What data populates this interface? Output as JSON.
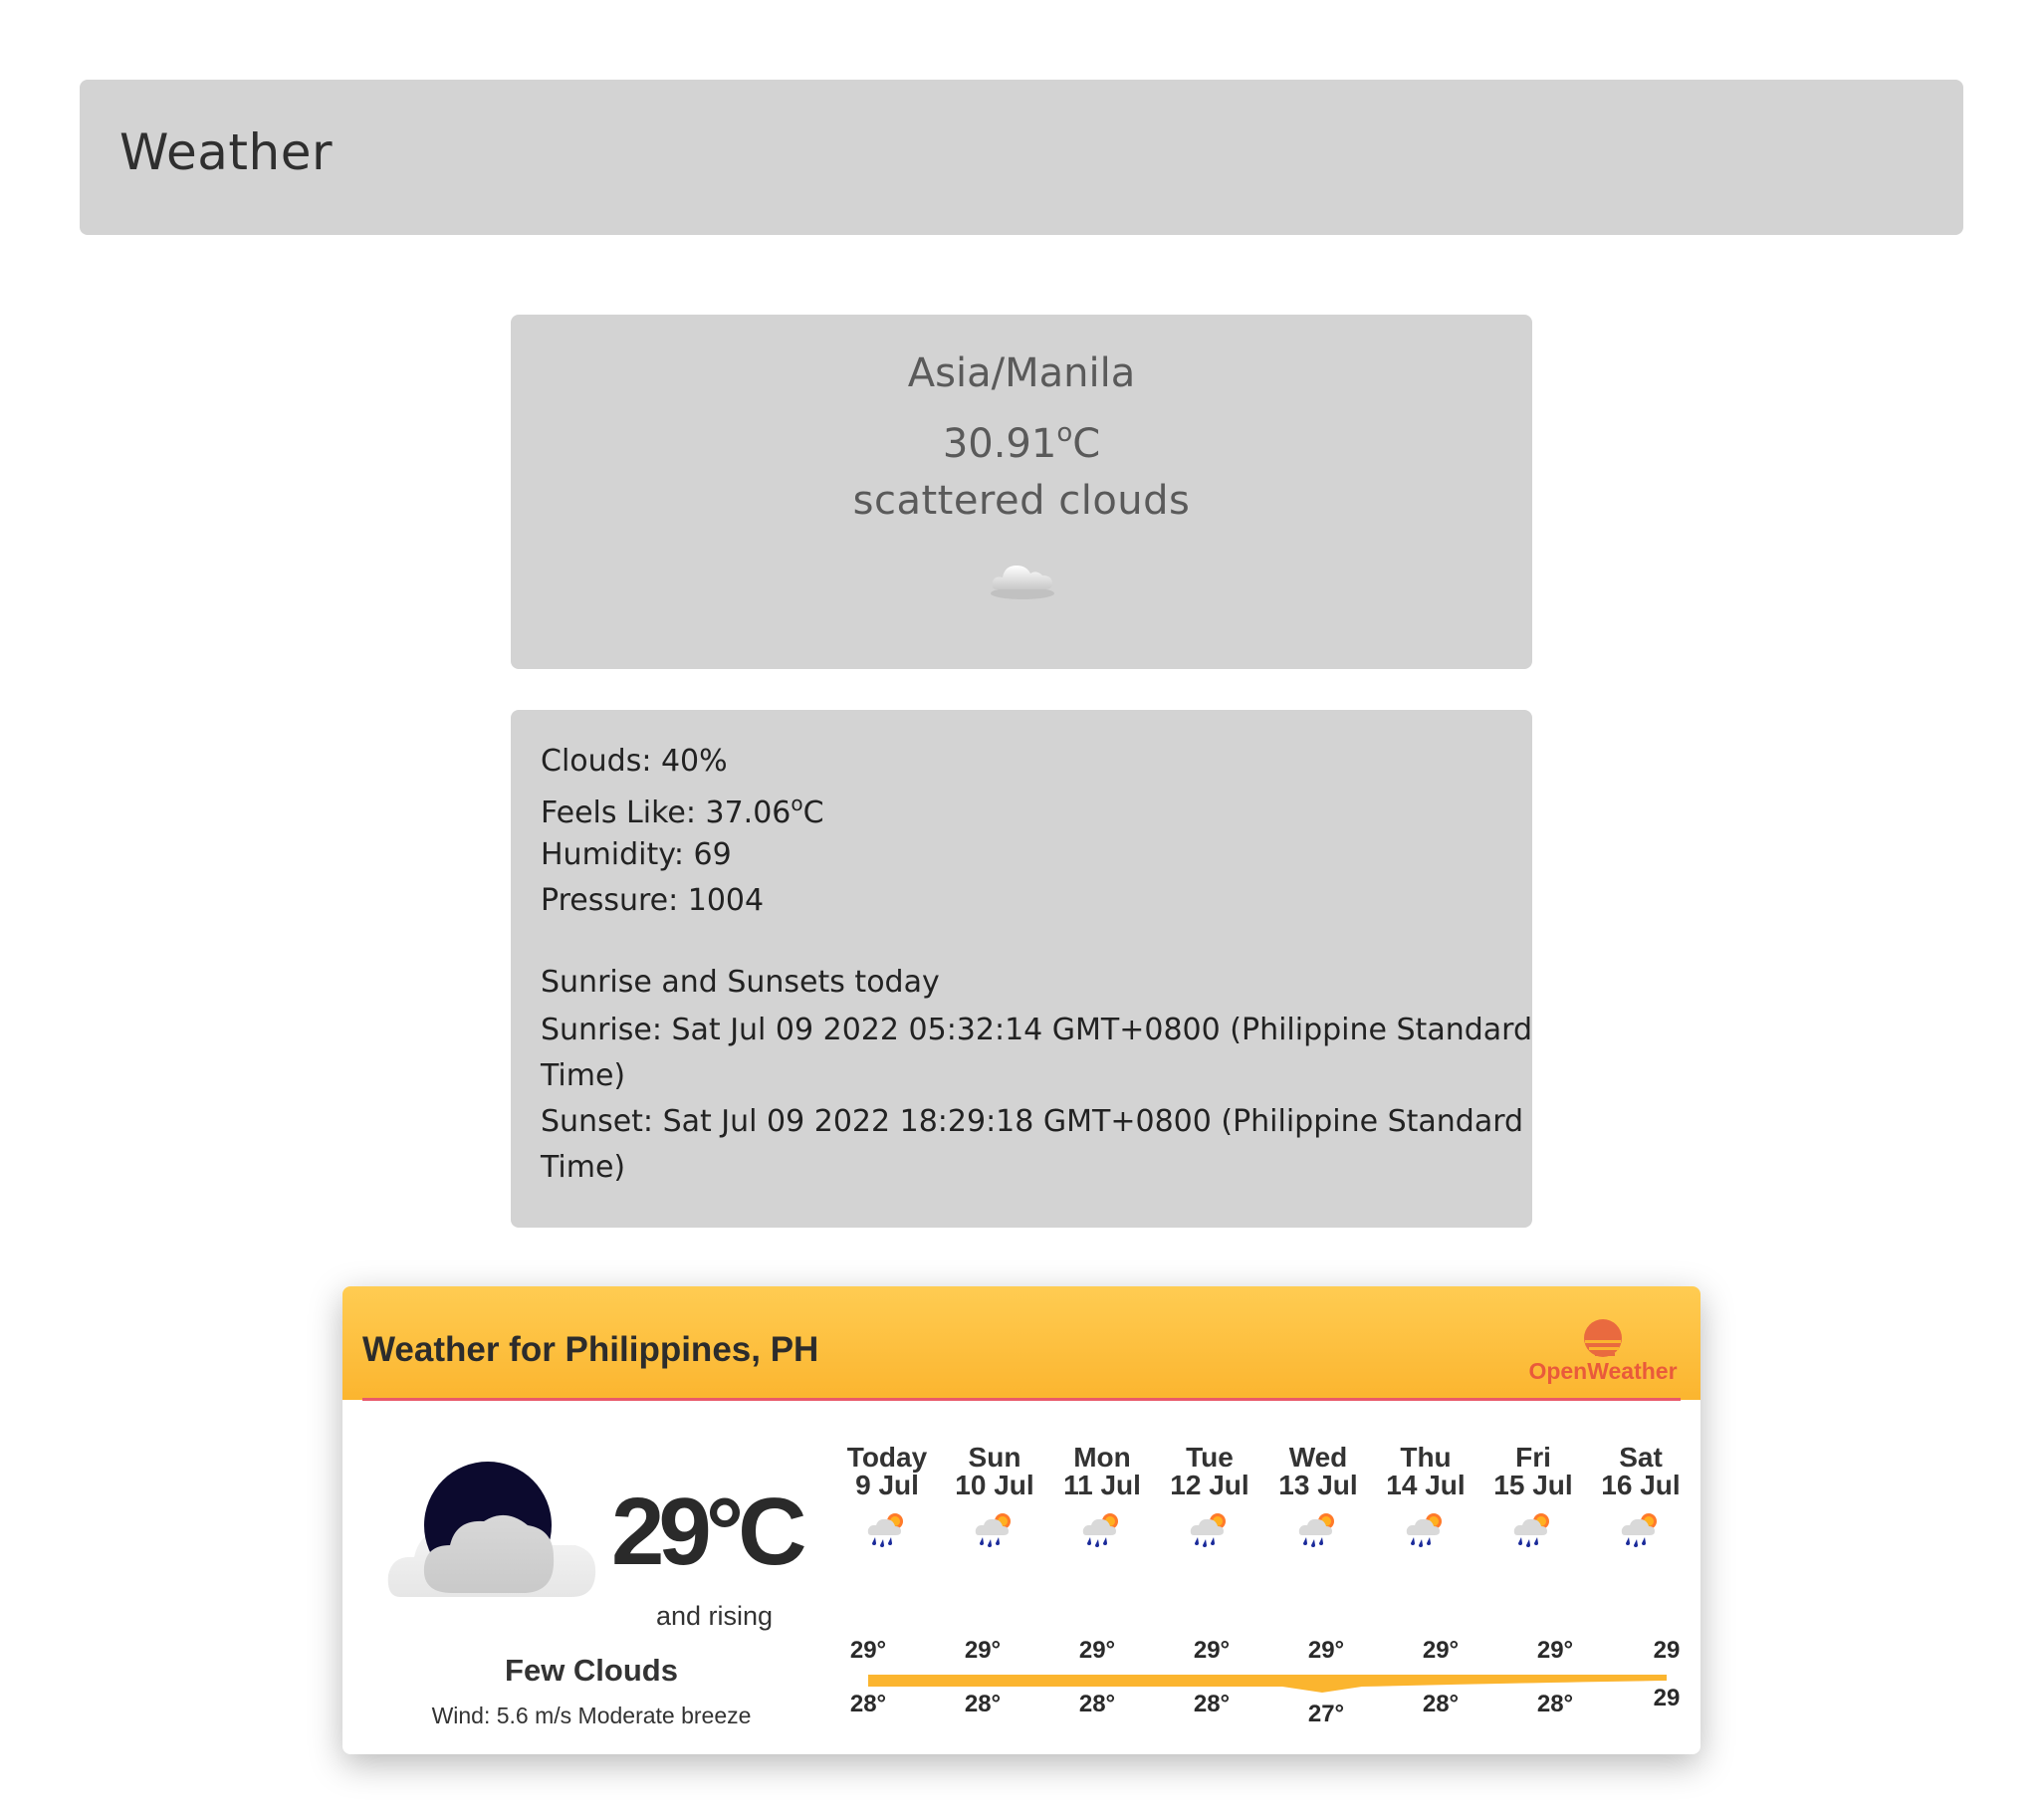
{
  "header": {
    "title": "Weather"
  },
  "current": {
    "location": "Asia/Manila",
    "temp_value": "30.91",
    "temp_unit_symbol": "o",
    "temp_unit_letter": "C",
    "description": "scattered clouds",
    "icon": "scattered-clouds-icon"
  },
  "details": {
    "clouds": "Clouds: 40%",
    "feels_like_prefix": "Feels Like: 37.06",
    "feels_like_sup": "o",
    "feels_like_unit": "C",
    "humidity": "Humidity: 69",
    "pressure": "Pressure: 1004",
    "sun_heading": "Sunrise and Sunsets today",
    "sunrise_line1": "Sunrise: Sat Jul 09 2022 05:32:14 GMT+0800 (Philippine Standard",
    "sunrise_line2": "Time)",
    "sunset_line1": "Sunset: Sat Jul 09 2022 18:29:18 GMT+0800 (Philippine Standard",
    "sunset_line2": "Time)"
  },
  "widget": {
    "title": "Weather for Philippines, PH",
    "logo_text": "OpenWeather",
    "accent_color": "#fbb52f",
    "current_temp": "29°C",
    "trend": "and rising",
    "description": "Few Clouds",
    "wind": "Wind: 5.6 m/s Moderate breeze",
    "forecast": [
      {
        "day": "Today",
        "date": "9 Jul",
        "high": "29°",
        "low": "28°"
      },
      {
        "day": "Sun",
        "date": "10 Jul",
        "high": "29°",
        "low": "28°"
      },
      {
        "day": "Mon",
        "date": "11 Jul",
        "high": "29°",
        "low": "28°"
      },
      {
        "day": "Tue",
        "date": "12 Jul",
        "high": "29°",
        "low": "28°"
      },
      {
        "day": "Wed",
        "date": "13 Jul",
        "high": "29°",
        "low": "27°"
      },
      {
        "day": "Thu",
        "date": "14 Jul",
        "high": "29°",
        "low": "28°"
      },
      {
        "day": "Fri",
        "date": "15 Jul",
        "high": "29°",
        "low": "28°"
      },
      {
        "day": "Sat",
        "date": "16 Jul",
        "high": "29",
        "low": "29"
      }
    ]
  }
}
